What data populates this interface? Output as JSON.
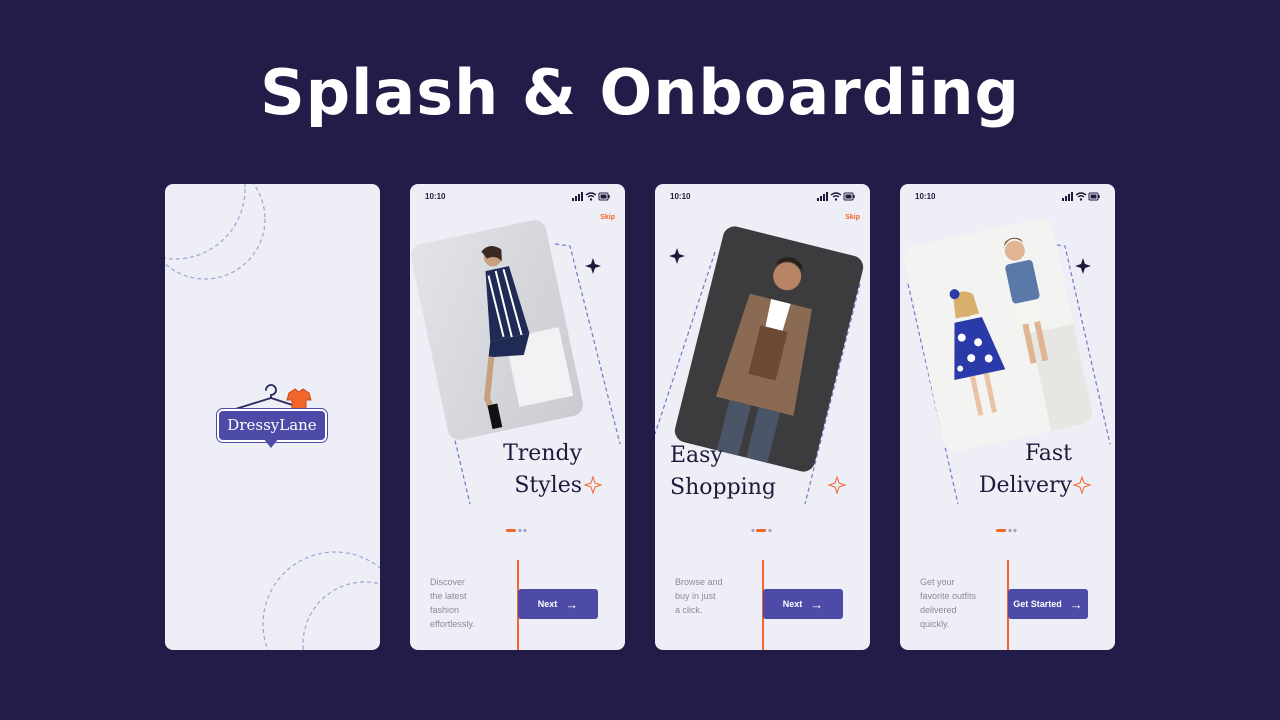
{
  "title": "Splash & Onboarding",
  "colors": {
    "background": "#221d48",
    "card": "#eeeef6",
    "accent": "#f0662b",
    "primary": "#4e4aa8",
    "text": "#1d1a3c"
  },
  "splash": {
    "logo_text": "DressyLane",
    "icons": [
      "hanger-icon",
      "shirt-icon"
    ]
  },
  "status_bar": {
    "time": "10:10",
    "icons": [
      "signal-icon",
      "wifi-icon",
      "battery-icon"
    ]
  },
  "onboarding": [
    {
      "skip": "Skip",
      "headline": [
        "Trendy",
        "Styles"
      ],
      "description": [
        "Discover",
        "the latest",
        "fashion",
        "effortlessly."
      ],
      "button": "Next",
      "active_dot": 1,
      "photo": "woman-in-striped-dress"
    },
    {
      "skip": "Skip",
      "headline": [
        "Easy",
        "Shopping"
      ],
      "description": [
        "Browse and",
        "buy in just",
        "a click."
      ],
      "button": "Next",
      "active_dot": 2,
      "photo": "man-in-brown-coat"
    },
    {
      "skip": "",
      "headline": [
        "Fast",
        "Delivery"
      ],
      "description": [
        "Get your",
        "favorite outfits",
        "delivered",
        "quickly."
      ],
      "button": "Get Started",
      "active_dot": 1,
      "photo": "two-children-in-outfits"
    }
  ]
}
